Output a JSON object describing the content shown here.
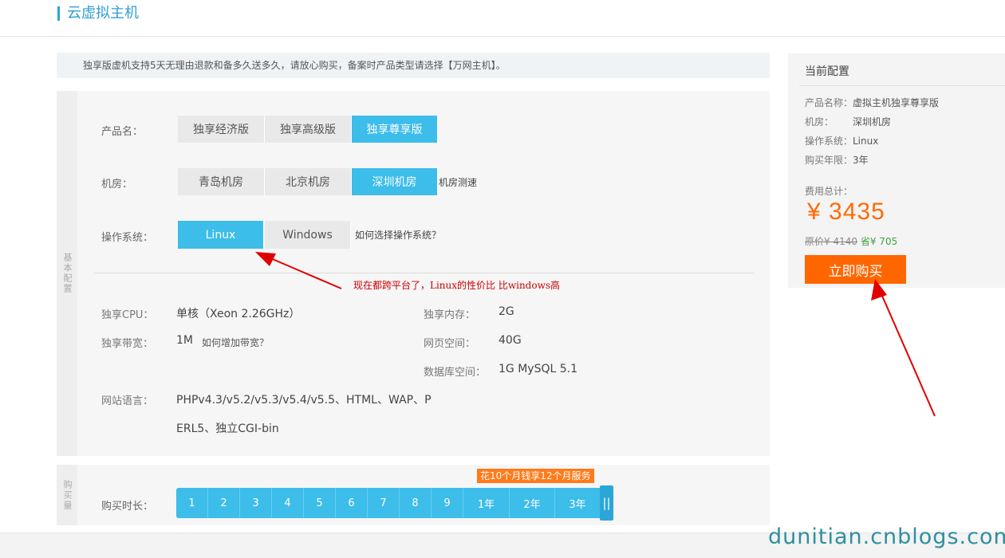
{
  "header": {
    "title": "云虚拟主机"
  },
  "notice": "独享版虚机支持5天无理由退款和备多久送多久，请放心购买，备案时产品类型请选择【万网主机】。",
  "basic_side_label": "基本配置",
  "product": {
    "label": "产品名：",
    "options": [
      "独享经济版",
      "独享高级版",
      "独享尊享版"
    ],
    "selected": "独享尊享版"
  },
  "room": {
    "label": "机房：",
    "options": [
      "青岛机房",
      "北京机房",
      "深圳机房"
    ],
    "selected": "深圳机房",
    "speed_link": "机房测速"
  },
  "os": {
    "label": "操作系统：",
    "options": [
      "Linux",
      "Windows"
    ],
    "selected": "Linux",
    "help_link": "如何选择操作系统？"
  },
  "annotation": "现在都跨平台了，Linux的性价比 比windows高",
  "specs": {
    "cpu_label": "独享CPU：",
    "cpu_value": "单核（Xeon 2.26GHz）",
    "mem_label": "独享内存：",
    "mem_value": "2G",
    "bw_label": "独享带宽：",
    "bw_value": "1M",
    "bw_link": "如何增加带宽？",
    "web_label": "网页空间：",
    "web_value": "40G",
    "db_label": "数据库空间：",
    "db_value": "1G MySQL 5.1",
    "lang_label": "网站语言：",
    "lang_line1": "PHPv4.3/v5.2/v5.3/v5.4/v5.5、HTML、WAP、P",
    "lang_line2": "ERL5、独立CGI-bin"
  },
  "purchase": {
    "side_label": "购买量",
    "label": "购买时长：",
    "promo": "花10个月钱享12个月服务",
    "options": [
      "1",
      "2",
      "3",
      "4",
      "5",
      "6",
      "7",
      "8",
      "9",
      "1年",
      "2年",
      "3年"
    ],
    "handle": "||"
  },
  "config": {
    "title": "当前配置",
    "product_k": "产品名称：",
    "product_v": "虚拟主机独享尊享版",
    "room_k": "机房：",
    "room_v": "深圳机房",
    "os_k": "操作系统：",
    "os_v": "Linux",
    "years_k": "购买年限：",
    "years_v": "3年",
    "total_label": "费用总计：",
    "price": "¥ 3435",
    "orig_prefix": "原价",
    "orig_price": "¥ 4140",
    "save_prefix": "省",
    "save_amount": "¥ 705",
    "buy_label": "立即购买"
  },
  "watermark": "dunitian.cnblogs.com",
  "colors": {
    "accent": "#3dbde9",
    "buy": "#ff6600",
    "price": "#ff6a00",
    "annotation_red": "#e00000"
  }
}
